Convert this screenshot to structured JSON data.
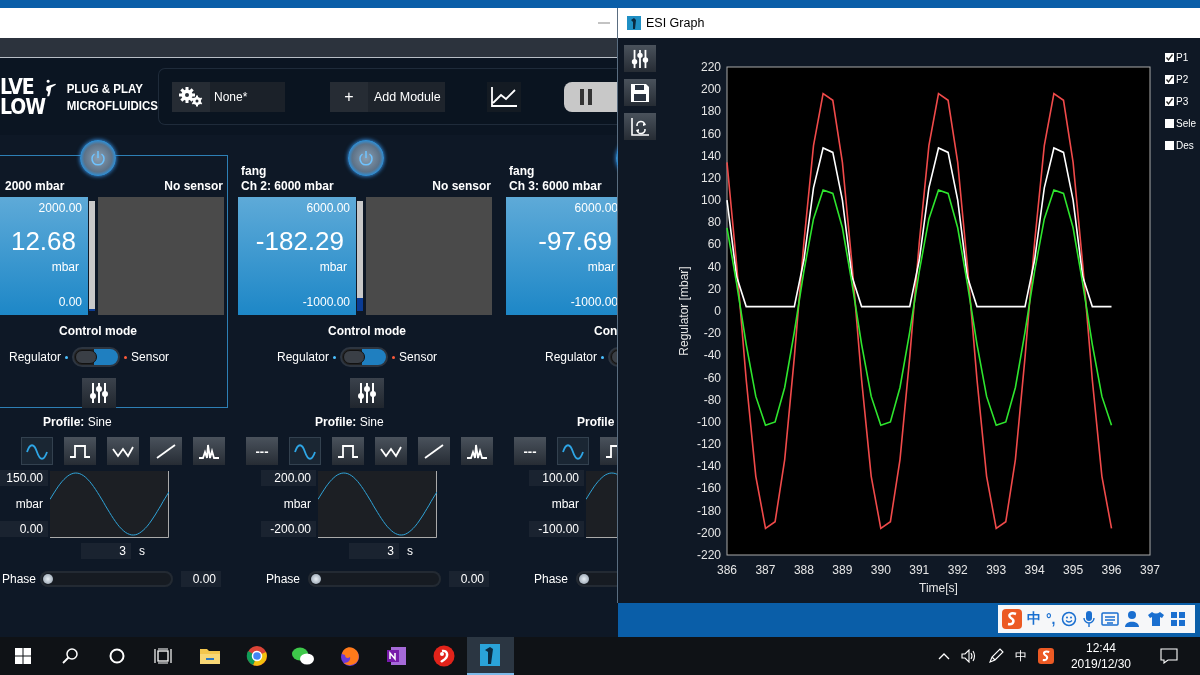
{
  "main_window": {
    "logo": {
      "line_1": "LVE",
      "line_2": "LOW",
      "tagline_1": "PLUG & PLAY",
      "tagline_2": "MICROFLUIDICS"
    },
    "toolbar": {
      "config": "None*",
      "add_symbol": "+",
      "add_label": "Add Module"
    },
    "channels": [
      {
        "selected": true,
        "title": "2000 mbar",
        "sensor": "No sensor",
        "max": "2000.00",
        "value": "12.68",
        "unit": "mbar",
        "min": "0.00",
        "level": 0.02,
        "mode_title": "Control mode",
        "left_label": "Regulator",
        "right_label": "Sensor",
        "sensor_mode": false,
        "profile_label": "Profile:",
        "profile": "Sine",
        "profiles": [
          {
            "kind": "sine",
            "selected": true
          },
          {
            "kind": "square",
            "selected": false
          },
          {
            "kind": "triangle",
            "selected": false
          },
          {
            "kind": "ramp",
            "selected": false
          },
          {
            "kind": "custom",
            "selected": false
          }
        ],
        "amp_max": "150.00",
        "amp_unit": "mbar",
        "amp_min": "0.00",
        "period": "3",
        "period_unit": "s",
        "phase_label": "Phase",
        "phase": {
          "level": 0
        },
        "phase_value": "0.00"
      },
      {
        "selected": false,
        "name": "fang",
        "title": "Ch 2: 6000 mbar",
        "sensor": "No sensor",
        "max": "6000.00",
        "value": "-182.29",
        "unit": "mbar",
        "min": "-1000.00",
        "level": 0.12,
        "mode_title": "Control mode",
        "left_label": "Regulator",
        "right_label": "Sensor",
        "sensor_mode": false,
        "profile_label": "Profile:",
        "profile": "Sine",
        "profiles": [
          {
            "kind": "none",
            "label": "---",
            "selected": false
          },
          {
            "kind": "sine",
            "selected": true
          },
          {
            "kind": "square",
            "selected": false
          },
          {
            "kind": "triangle",
            "selected": false
          },
          {
            "kind": "ramp",
            "selected": false
          },
          {
            "kind": "custom",
            "selected": false
          }
        ],
        "amp_max": "200.00",
        "amp_unit": "mbar",
        "amp_min": "-200.00",
        "period": "3",
        "period_unit": "s",
        "phase_label": "Phase",
        "phase": {
          "level": 0
        },
        "phase_value": "0.00"
      },
      {
        "selected": false,
        "name": "fang",
        "title": "Ch 3: 6000 mbar",
        "max": "6000.00",
        "value": "-97.69",
        "unit": "mbar",
        "min": "-1000.00",
        "mode_title": "Con",
        "left_label": "Regulator",
        "sensor_mode": false,
        "profile_label": "Profile",
        "profiles": [
          {
            "kind": "none",
            "label": "---",
            "selected": false
          },
          {
            "kind": "sine",
            "selected": true
          },
          {
            "kind": "square",
            "selected": false
          }
        ],
        "amp_max": "100.00",
        "amp_unit": "mbar",
        "amp_min": "-100.00",
        "phase_label": "Phase",
        "phase": {
          "level": 0
        }
      }
    ]
  },
  "graph_window": {
    "title": "ESI Graph",
    "legend": [
      {
        "checked": true
      },
      {
        "checked": true
      },
      {
        "checked": true
      },
      {
        "label": "Sele",
        "checked": false
      },
      {
        "label": "Des",
        "checked": false
      }
    ],
    "chart_data": {
      "type": "line",
      "xlabel": "Time[s]",
      "ylabel": "Regulator [mbar]",
      "x": [
        386,
        386.25,
        386.5,
        386.75,
        387,
        387.25,
        387.5,
        387.75,
        388,
        388.25,
        388.5,
        388.75,
        389,
        389.25,
        389.5,
        389.75,
        390,
        390.25,
        390.5,
        390.75,
        391,
        391.25,
        391.5,
        391.75,
        392,
        392.25,
        392.5,
        392.75,
        393,
        393.25,
        393.5,
        393.75,
        394,
        394.25,
        394.5,
        394.75,
        395,
        395.25,
        395.5,
        395.75,
        396
      ],
      "series": [
        {
          "name": "P1",
          "color": "#f04a4a",
          "values": [
            134,
            42,
            -62,
            -149,
            -196,
            -190,
            -134,
            -42,
            62,
            149,
            196,
            190,
            134,
            42,
            -62,
            -149,
            -196,
            -190,
            -134,
            -42,
            62,
            149,
            196,
            190,
            134,
            42,
            -62,
            -149,
            -196,
            -190,
            -134,
            -42,
            62,
            149,
            196,
            190,
            134,
            42,
            -62,
            -149,
            -196
          ]
        },
        {
          "name": "P2",
          "color": "#ffffff",
          "values": [
            100,
            31,
            4,
            4,
            4,
            4,
            4,
            4,
            46,
            111,
            147,
            143,
            100,
            31,
            4,
            4,
            4,
            4,
            4,
            4,
            46,
            111,
            147,
            143,
            100,
            31,
            4,
            4,
            4,
            4,
            4,
            4,
            46,
            111,
            147,
            143,
            100,
            31,
            4,
            4,
            4
          ]
        },
        {
          "name": "P3",
          "color": "#2ee52e",
          "values": [
            75,
            25,
            -30,
            -77,
            -103,
            -100,
            -69,
            -19,
            36,
            83,
            109,
            106,
            75,
            25,
            -30,
            -77,
            -103,
            -100,
            -69,
            -19,
            36,
            83,
            109,
            106,
            75,
            25,
            -30,
            -77,
            -103,
            -100,
            -69,
            -19,
            36,
            83,
            109,
            106,
            75,
            25,
            -30,
            -77,
            -103
          ]
        }
      ],
      "xlim": [
        386,
        397
      ],
      "ylim": [
        -220,
        220
      ],
      "xticks": [
        386,
        387,
        388,
        389,
        390,
        391,
        392,
        393,
        394,
        395,
        396,
        397
      ],
      "yticks": [
        -220,
        -200,
        -180,
        -160,
        -140,
        -120,
        -100,
        -80,
        -60,
        -40,
        -20,
        0,
        20,
        40,
        60,
        80,
        100,
        120,
        140,
        160,
        180,
        200,
        220
      ]
    }
  },
  "ime_bar": {
    "lang": "中",
    "punct": "°,"
  },
  "taskbar": {
    "apps": [
      {
        "kind": "start",
        "selected": false
      },
      {
        "kind": "search",
        "selected": false
      },
      {
        "kind": "cortana",
        "selected": false
      },
      {
        "kind": "taskview",
        "selected": false
      },
      {
        "kind": "folder",
        "selected": false
      },
      {
        "kind": "globe",
        "selected": false
      },
      {
        "kind": "chat",
        "selected": false
      },
      {
        "kind": "flame",
        "selected": false
      },
      {
        "kind": "notes",
        "selected": false
      },
      {
        "kind": "swirl",
        "selected": false
      },
      {
        "kind": "app",
        "selected": true
      }
    ],
    "tray": {
      "lang": "中",
      "time": "12:44",
      "date": "2019/12/30"
    }
  }
}
